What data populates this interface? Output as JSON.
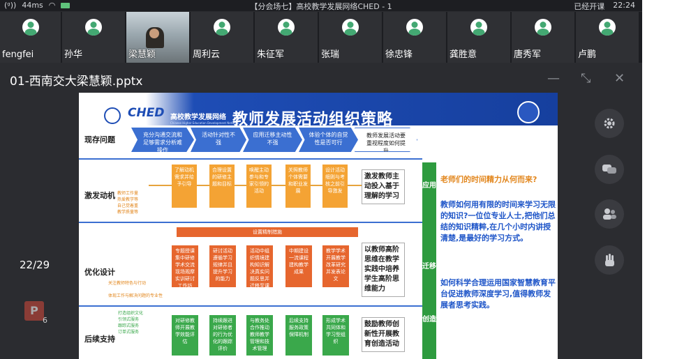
{
  "status": {
    "signal": "(ᵍ))",
    "speed": "44ms",
    "title": "【分会场七】高校教学发展网络CHED - 1",
    "right_status": "已经开课",
    "time": "22:24"
  },
  "participants": [
    {
      "name": "fengfei",
      "video": false
    },
    {
      "name": "孙华",
      "video": false
    },
    {
      "name": "梁慧颖",
      "video": true
    },
    {
      "name": "周利云",
      "video": false
    },
    {
      "name": "朱征军",
      "video": false
    },
    {
      "name": "张瑞",
      "video": false
    },
    {
      "name": "徐忠锋",
      "video": false
    },
    {
      "name": "龚胜意",
      "video": false
    },
    {
      "name": "唐秀军",
      "video": false
    },
    {
      "name": "卢鹏",
      "video": false
    }
  ],
  "file": {
    "name": "01-西南交大梁慧颖.pptx",
    "page": "22/29",
    "ppt_badge": "P",
    "ppt_count": "6"
  },
  "icons": {
    "minimize": "minimize-icon",
    "shrink": "shrink-icon",
    "close": "close-icon",
    "settings": "gear-icon",
    "chat": "chat-icon",
    "members": "members-icon",
    "hand": "raise-hand-icon"
  },
  "slide": {
    "title": "教师发展活动组织策略",
    "logo": "CHED",
    "net_cn": "高校教学发展网络",
    "net_en": "Chinese Higher Education Development Network",
    "rows": [
      "现存问题",
      "激发动机",
      "优化设计",
      "后续支持"
    ],
    "problems": [
      "充分沟通交流和足够需求分析难操作",
      "活动针对性不强",
      "应用迁移主动性不强",
      "体验个体的自觉性是否可行",
      "教师发展活动要重视程度如何提升"
    ],
    "motive_side": [
      "教师工作量",
      "热爱教学等",
      "自己觉着重",
      "教学质量等"
    ],
    "motive_boxes": [
      "了解动机需求并给予引导",
      "合理设置的研修主题和目标",
      "唤醒主动参与和专家引领的活动",
      "关照教师个体需要和职业发展",
      "设计活动细则与考核之前引导激发"
    ],
    "motive_key": "激发教师主动投入基于理解的学习",
    "design_bar": "设置精制措施",
    "design_side": [
      "关注教师特色与行动",
      "体现工作与解决问题的专业性"
    ],
    "design_boxes": [
      "专题授课集中研修学术交流现场观摩实训研讨工作坊",
      "研讨活动遵循学习规律并且提升学习的能力",
      "活动中组织情境建构知识解决真实问题反思并迁移至课堂",
      "中期建设一流课程建构教学成果",
      "教学学术开展教学改革研究并发表论文"
    ],
    "design_key": "以教师高阶思维在教学实践中培养学生高阶思维能力",
    "support_side": [
      "打造组织文化",
      "引领式服务",
      "跟踪式服务",
      "订单式服务"
    ],
    "support_boxes": [
      "对研修教师开展教学效能评估",
      "持续跟进对研修者的行为优化的跟踪评价",
      "与教务处合作推动教师教学管理和技术管理",
      "后续支持服务政策保障机制",
      "形成学术共同体和学习型组织"
    ],
    "support_key": "鼓励教师创新性开展教育创造活动",
    "side_labels": [
      "应用",
      "迁移",
      "创造"
    ],
    "right_q": "老师们的时间精力从何而来?",
    "right_p1": "教师如何用有限的时间来学习无限的知识?一位位专业人士,把他们总结的知识精粹,在几个小时内讲授清楚,是最好的学习方式。",
    "right_p2": "如何科学合理运用国家智慧教育平台促进教师深度学习,值得教师发展者思考实践。",
    "colors": {
      "question": "#e2861c",
      "body": "#1e55c8"
    }
  }
}
